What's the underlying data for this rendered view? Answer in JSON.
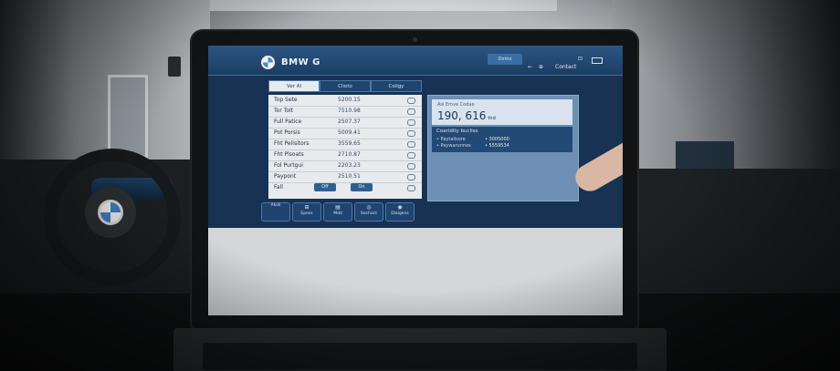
{
  "app": {
    "brand": "BMW G",
    "top_tab": "Demo",
    "top_label": "Contact",
    "top_icons": [
      "←",
      "⊕",
      "⊡"
    ]
  },
  "segments": [
    {
      "label": "Ver Al",
      "active": true
    },
    {
      "label": "Clioto",
      "active": false
    },
    {
      "label": "Coilgy",
      "active": false
    }
  ],
  "rows": [
    {
      "label": "Top Sete",
      "value": "5200.15"
    },
    {
      "label": "Tor Tolt",
      "value": "7510.98"
    },
    {
      "label": "Full Patice",
      "value": "2507.37"
    },
    {
      "label": "Pot Porsis",
      "value": "5009.41"
    },
    {
      "label": "Fht Pelisitors",
      "value": "3559.65"
    },
    {
      "label": "Fht Plsoats",
      "value": "2710.87"
    },
    {
      "label": "Fol Purtgui",
      "value": "2203.23"
    },
    {
      "label": "Paypont",
      "value": "2510.51"
    },
    {
      "label": "Fall",
      "pills": [
        "Off",
        "On"
      ]
    }
  ],
  "panel": {
    "kicker": "Asl Emve Codae",
    "value": "190, 616",
    "unit": "tnd",
    "title": "Coaridity bucliss",
    "lines": [
      {
        "label": "• Paytallsore",
        "value": "• 3005000"
      },
      {
        "label": "• Paywarunnes",
        "value": "• 5559534"
      }
    ]
  },
  "bottom": [
    {
      "label": "Aksk",
      "glyph": ""
    },
    {
      "label": "Eposs",
      "glyph": "⊞"
    },
    {
      "label": "Mdd",
      "glyph": "▤"
    },
    {
      "label": "Sechact",
      "glyph": "◎"
    },
    {
      "label": "Diaigens",
      "glyph": "◉"
    }
  ]
}
